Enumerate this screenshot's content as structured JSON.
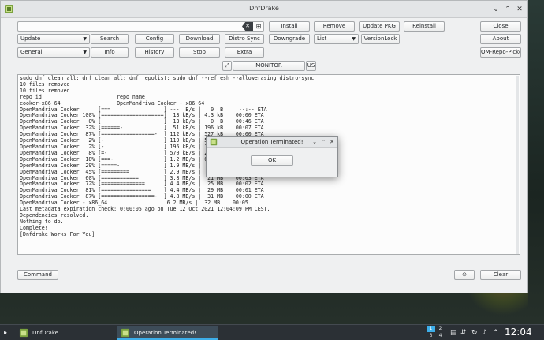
{
  "window": {
    "title": "DnfDrake"
  },
  "search": {
    "value": "",
    "placeholder": ""
  },
  "row1": {
    "install": "Install",
    "remove": "Remove",
    "update_pkg": "Update PKG",
    "reinstall": "Reinstall",
    "close": "Close"
  },
  "row2": {
    "mode_select": "Update",
    "search": "Search",
    "config": "Config",
    "download": "Download",
    "distro_sync": "Distro Sync",
    "downgrade": "Downgrade",
    "list_select": "List",
    "versionlock": "VersionLock",
    "about": "About"
  },
  "row3": {
    "group_select": "General",
    "info": "Info",
    "history": "History",
    "stop": "Stop",
    "extra": "Extra",
    "om_repo_picker": "OM-Repo-Picker"
  },
  "monitor": {
    "label": "MONITOR",
    "lang": "US"
  },
  "terminal": {
    "lines": [
      "sudo dnf clean all; dnf clean all; dnf repolist; sudo dnf --refresh --allowerasing distro-sync",
      "10 files removed",
      "10 files removed",
      "repo id                        repo name",
      "cooker-x86_64                  OpenMandriva Cooker - x86_64",
      "OpenMandriva Cooker      [===                 ] ---  B/s |   0  B     --:-- ETA",
      "OpenMandriva Cooker 100% [====================]  13 kB/s | 4.3 kB    00:00 ETA",
      "OpenMandriva Cooker   0% [                    ]  13 kB/s |   0  B    00:46 ETA",
      "OpenMandriva Cooker  32% [======-             ]  51 kB/s | 196 kB    00:07 ETA",
      "OpenMandriva Cooker  87% [=================-  ] 112 kB/s | 527 kB    00:00 ETA",
      "OpenMandriva Cooker   2% [-                   ] 119 kB/s | 599 kB    00:00 ETA",
      "OpenMandriva Cooker   2% [-                   ] 196 kB/s | 1.0 MB    00:00 ETA",
      "OpenMandriva Cooker   8% [=-                  ] 570 kB/s | 2.9 MB    00:00 ETA",
      "OpenMandriva Cooker  18% [===-                ] 1.2 MB/s | 6.3 MB    00:00 ETA",
      "OpenMandriva Cooker  29% [=====-              ] 1.9 MB/s |  10 MB    00:00 ETA",
      "OpenMandriva Cooker  45% [=========           ] 2.9 MB/s |  16 MB    00:00 ETA",
      "OpenMandriva Cooker  60% [============        ] 3.8 MB/s |  21 MB    00:03 ETA",
      "OpenMandriva Cooker  72% [==============      ] 4.4 MB/s |  25 MB    00:02 ETA",
      "OpenMandriva Cooker  81% [================    ] 4.4 MB/s |  29 MB    00:01 ETA",
      "OpenMandriva Cooker  87% [=================-  ] 4.8 MB/s |  31 MB    00:00 ETA",
      "OpenMandriva Cooker - x86_64                   6.2 MB/s |  32 MB    00:05",
      "Last metadata expiration check: 0:00:05 ago on Tue 12 Oct 2021 12:04:09 PM CEST.",
      "Dependencies resolved.",
      "Nothing to do.",
      "Complete!",
      "[Dnfdrake Works For You]"
    ]
  },
  "bottom": {
    "command": "Command",
    "clear": "Clear"
  },
  "dialog": {
    "title": "Operation Terminated!",
    "ok": "OK"
  },
  "taskbar": {
    "tasks": [
      "DnfDrake",
      "Operation Terminated!"
    ],
    "pager": [
      "1",
      "2",
      "3",
      "4"
    ],
    "clock": "12:04"
  },
  "colors": {
    "accent": "#3daee9",
    "window_bg": "#eff0f1",
    "taskbar_bg": "#2b3035"
  },
  "icons": {
    "app": "dnfdrake-icon"
  }
}
